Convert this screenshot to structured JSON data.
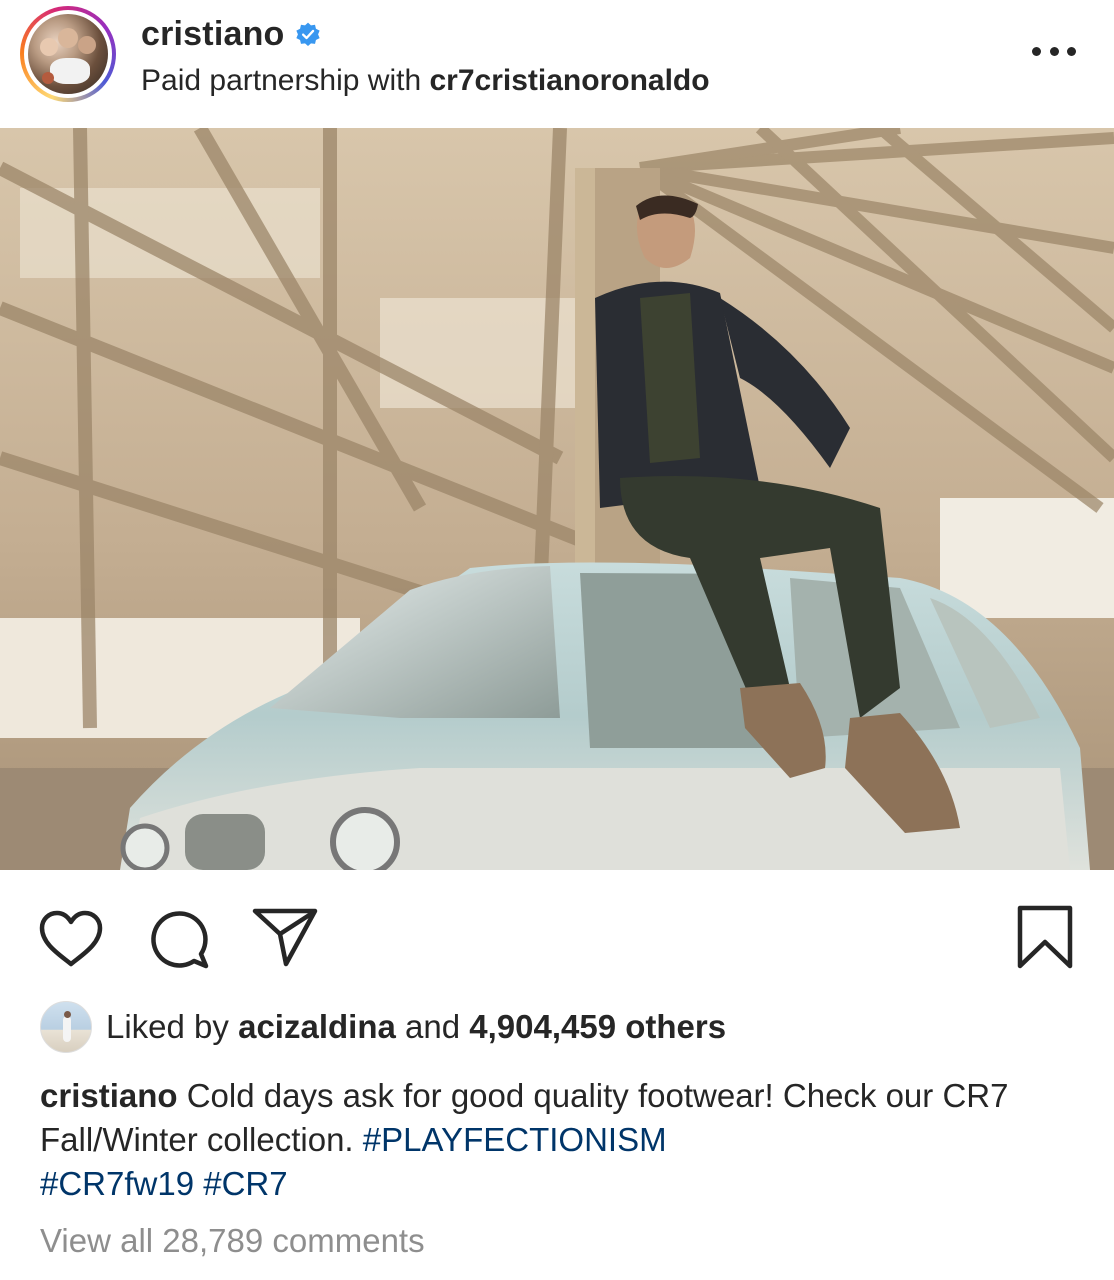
{
  "post": {
    "author": {
      "username": "cristiano",
      "verified": true,
      "avatar_icon": "profile-photo"
    },
    "partnership": {
      "prefix": "Paid partnership with",
      "partner": "cr7cristianoronaldo"
    },
    "photo": {
      "description_icon": "post-photo"
    },
    "actions": {
      "like_icon": "heart-icon",
      "comment_icon": "comment-icon",
      "share_icon": "share-icon",
      "save_icon": "bookmark-icon"
    },
    "likes": {
      "prefix": "Liked by",
      "user": "acizaldina",
      "middle": "and",
      "count": "4,904,459 others"
    },
    "caption": {
      "author": "cristiano",
      "text": "Cold days ask for good quality footwear! Check our CR7 Fall/Winter collection.",
      "hashtags": [
        "#PLAYFECTIONISM",
        "#CR7fw19",
        "#CR7"
      ]
    },
    "comments_link": "View all 28,789 comments"
  },
  "colors": {
    "text": "#262626",
    "hashtag": "#003569",
    "muted": "#8e8e8e",
    "verified": "#3897f0"
  }
}
